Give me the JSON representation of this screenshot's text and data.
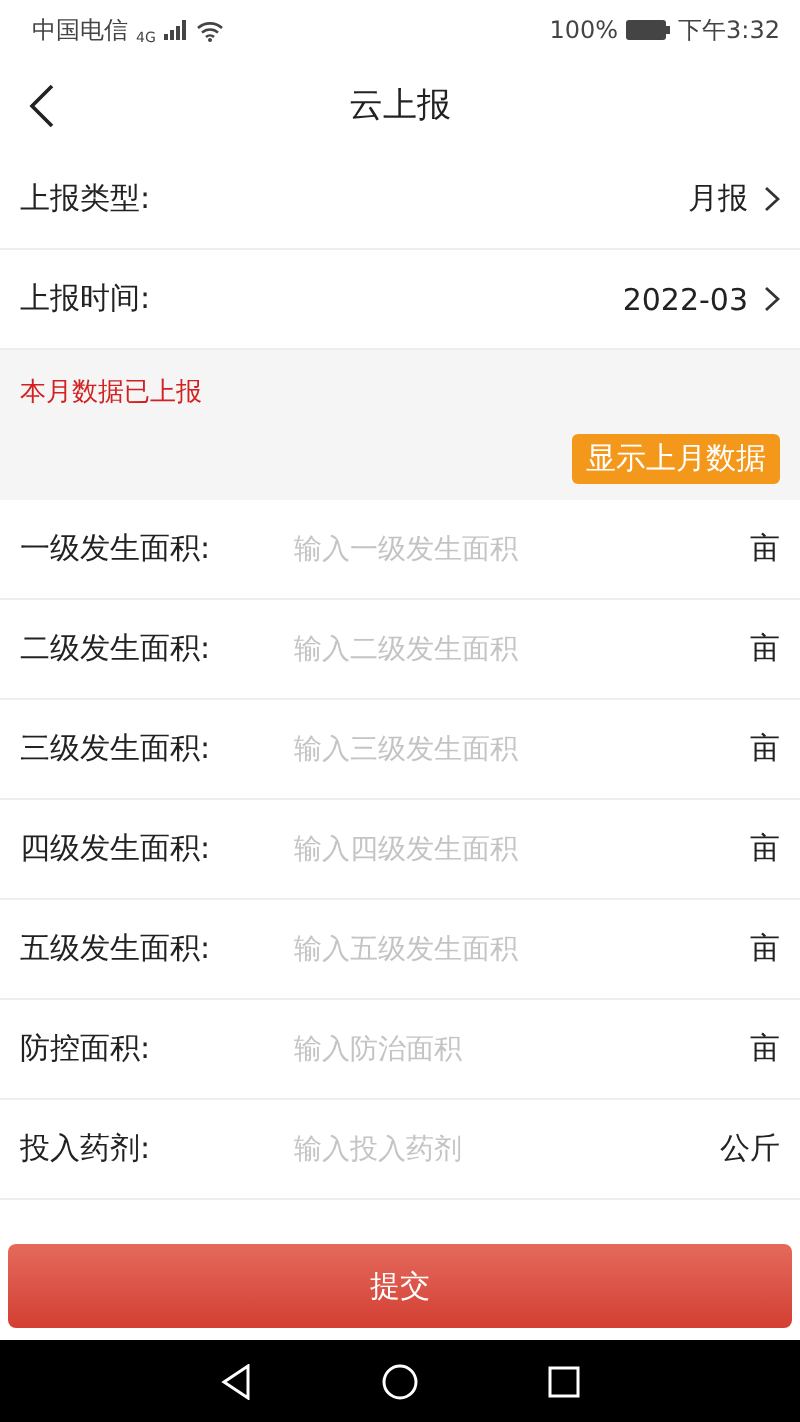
{
  "status_bar": {
    "carrier": "中国电信",
    "network": "4G",
    "battery": "100%",
    "time": "下午3:32"
  },
  "header": {
    "title": "云上报"
  },
  "selects": [
    {
      "label": "上报类型:",
      "value": "月报"
    },
    {
      "label": "上报时间:",
      "value": "2022-03"
    }
  ],
  "notice": {
    "message": "本月数据已上报",
    "button": "显示上月数据"
  },
  "fields": [
    {
      "label": "一级发生面积:",
      "placeholder": "输入一级发生面积",
      "unit": "亩"
    },
    {
      "label": "二级发生面积:",
      "placeholder": "输入二级发生面积",
      "unit": "亩"
    },
    {
      "label": "三级发生面积:",
      "placeholder": "输入三级发生面积",
      "unit": "亩"
    },
    {
      "label": "四级发生面积:",
      "placeholder": "输入四级发生面积",
      "unit": "亩"
    },
    {
      "label": "五级发生面积:",
      "placeholder": "输入五级发生面积",
      "unit": "亩"
    },
    {
      "label": "防控面积:",
      "placeholder": "输入防治面积",
      "unit": "亩"
    },
    {
      "label": "投入药剂:",
      "placeholder": "输入投入药剂",
      "unit": "公斤"
    }
  ],
  "submit": "提交"
}
